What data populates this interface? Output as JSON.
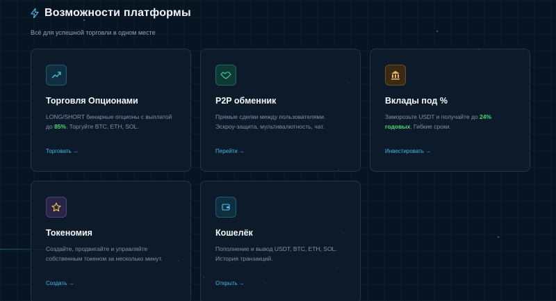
{
  "header": {
    "title": "Возможности платформы",
    "subtitle": "Всё для успешной торговли в одном месте"
  },
  "cards": [
    {
      "title": "Торговля Опционами",
      "desc_a": "LONG/SHORT бинарные опционы с выплатой до ",
      "desc_hl": "85%",
      "desc_b": ". Торгуйте BTC, ETH, SOL.",
      "link": "Торговать →",
      "icon": "trend-up-icon"
    },
    {
      "title": "P2P обменник",
      "desc_a": "Прямые сделки между пользователями. Эскроу-защита, мультивалютность, чат.",
      "desc_hl": "",
      "desc_b": "",
      "link": "Перейти →",
      "icon": "handshake-icon"
    },
    {
      "title": "Вклады под %",
      "desc_a": "Заморозьте USDT и получайте до ",
      "desc_hl": "24% годовых",
      "desc_b": ". Гибкие сроки.",
      "link": "Инвестировать →",
      "icon": "bank-icon"
    },
    {
      "title": "Токеномия",
      "desc_a": "Создайте, продвигайте и управляйте собственным токеном за несколько минут.",
      "desc_hl": "",
      "desc_b": "",
      "link": "Создать →",
      "icon": "star-icon"
    },
    {
      "title": "Кошелёк",
      "desc_a": "Пополнение и вывод USDT, BTC, ETH, SOL. История транзакций.",
      "desc_hl": "",
      "desc_b": "",
      "link": "Открыть →",
      "icon": "wallet-icon"
    }
  ]
}
